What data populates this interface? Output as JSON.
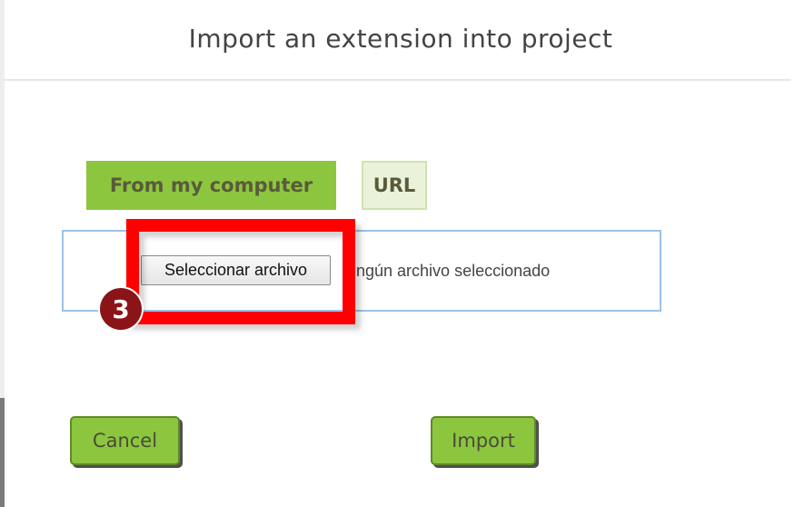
{
  "dialog": {
    "title": "Import an extension into project"
  },
  "tabs": [
    {
      "label": "From my computer",
      "active": true
    },
    {
      "label": "URL",
      "active": false
    }
  ],
  "file_input": {
    "button_label": "Seleccionar archivo",
    "status_text": "ngún archivo seleccionado"
  },
  "annotation": {
    "step_number": "3",
    "highlight_color": "#ff0000",
    "badge_color": "#8a1417"
  },
  "actions": {
    "cancel_label": "Cancel",
    "import_label": "Import"
  },
  "colors": {
    "accent_green": "#8cc63f",
    "inactive_tab": "#eaf3da",
    "file_area_border": "#9cc2e6"
  }
}
